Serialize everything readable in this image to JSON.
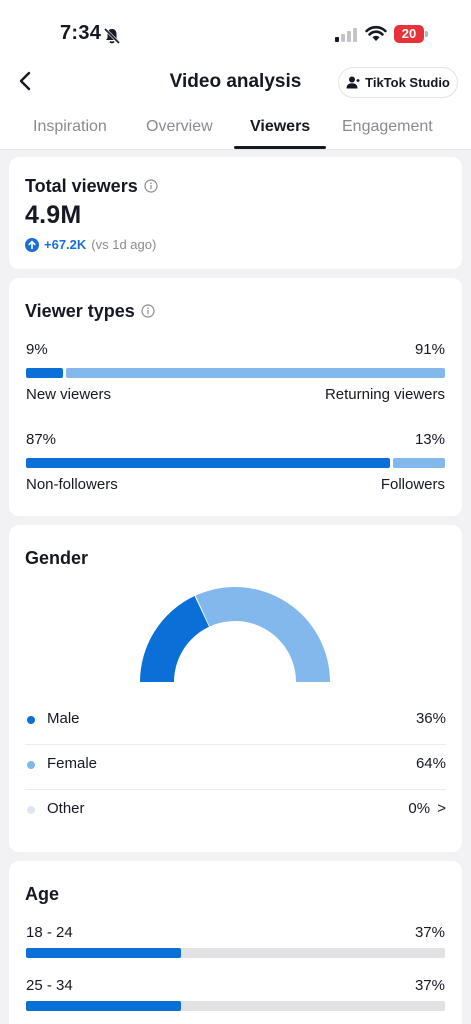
{
  "status_bar": {
    "time": "7:34",
    "battery": "20"
  },
  "header": {
    "title": "Video analysis",
    "studio_label": "TikTok Studio",
    "tabs": [
      "Inspiration",
      "Overview",
      "Viewers",
      "Engagement"
    ],
    "active_tab": "Viewers"
  },
  "total_viewers": {
    "title": "Total viewers",
    "value": "4.9M",
    "change": "+67.2K",
    "change_note": "(vs 1d ago)"
  },
  "viewer_types": {
    "title": "Viewer types",
    "new_vs_returning": {
      "left_pct": "9%",
      "right_pct": "91%",
      "left_label": "New viewers",
      "right_label": "Returning viewers",
      "left_fraction": 0.09
    },
    "followers": {
      "left_pct": "87%",
      "right_pct": "13%",
      "left_label": "Non-followers",
      "right_label": "Followers",
      "left_fraction": 0.87
    }
  },
  "gender": {
    "title": "Gender",
    "items": [
      {
        "label": "Male",
        "value": "36%",
        "fraction": 0.36,
        "color": "#0a6fd6"
      },
      {
        "label": "Female",
        "value": "64%",
        "fraction": 0.64,
        "color": "#82b8ec"
      },
      {
        "label": "Other",
        "value": "0%",
        "fraction": 0.0,
        "color": "#dbe6f5"
      }
    ],
    "chevron": ">"
  },
  "age": {
    "title": "Age",
    "items": [
      {
        "label": "18 - 24",
        "value": "37%",
        "fraction": 0.37
      },
      {
        "label": "25 - 34",
        "value": "37%",
        "fraction": 0.37
      }
    ]
  },
  "colors": {
    "accent": "#0a6fd6",
    "accent_light": "#82b8ec",
    "track": "#e2e2e4",
    "background": "#f2f2f4"
  }
}
